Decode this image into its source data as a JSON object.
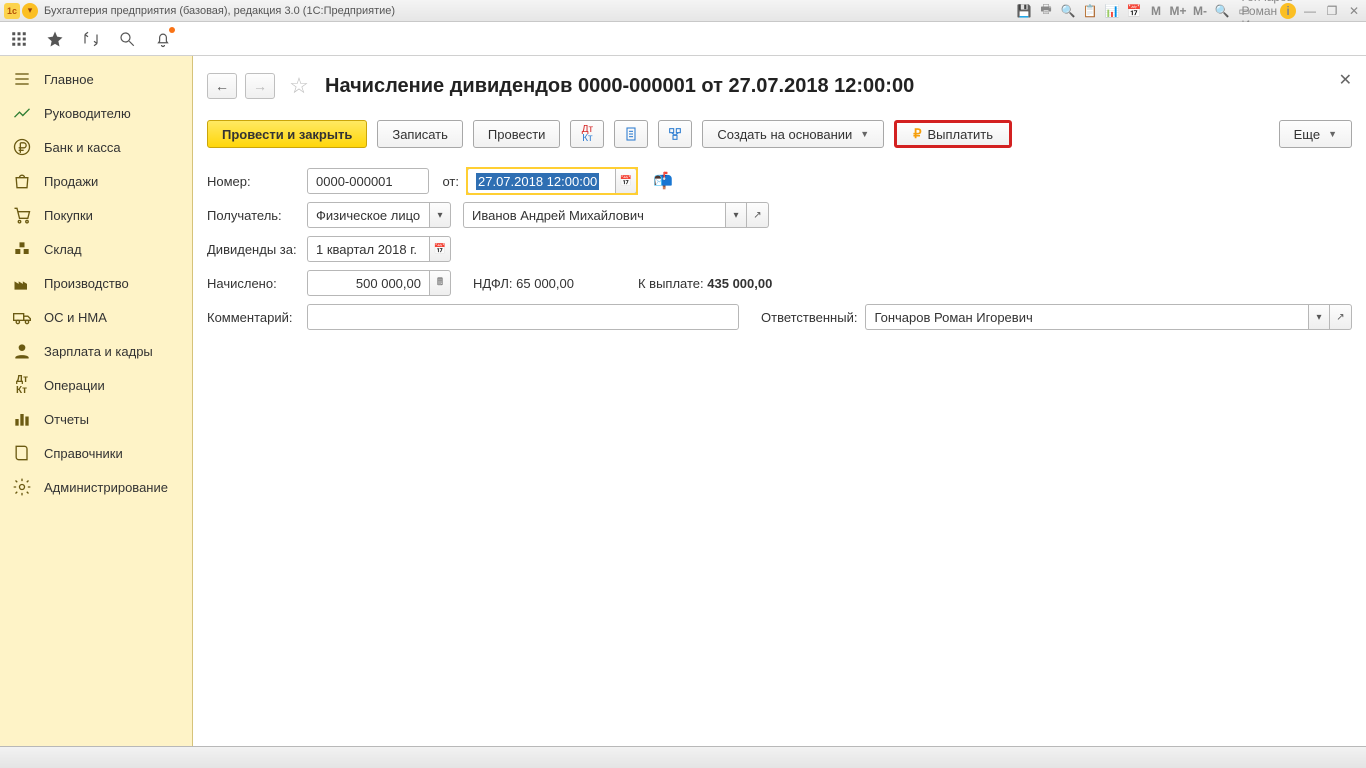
{
  "window": {
    "title": "Бухгалтерия предприятия (базовая), редакция 3.0  (1С:Предприятие)",
    "user": "Гончаров Роман Игоревич",
    "m_labels": [
      "M",
      "M+",
      "M-"
    ]
  },
  "sidebar": {
    "items": [
      {
        "label": "Главное"
      },
      {
        "label": "Руководителю"
      },
      {
        "label": "Банк и касса"
      },
      {
        "label": "Продажи"
      },
      {
        "label": "Покупки"
      },
      {
        "label": "Склад"
      },
      {
        "label": "Производство"
      },
      {
        "label": "ОС и НМА"
      },
      {
        "label": "Зарплата и кадры"
      },
      {
        "label": "Операции"
      },
      {
        "label": "Отчеты"
      },
      {
        "label": "Справочники"
      },
      {
        "label": "Администрирование"
      }
    ]
  },
  "page": {
    "title": "Начисление дивидендов 0000-000001 от 27.07.2018 12:00:00"
  },
  "toolbar": {
    "post_close": "Провести и закрыть",
    "save": "Записать",
    "post": "Провести",
    "create_based": "Создать на основании",
    "payout": "Выплатить",
    "more": "Еще"
  },
  "form": {
    "number_label": "Номер:",
    "number_value": "0000-000001",
    "from_label": "от:",
    "date_value": "27.07.2018 12:00:00",
    "recipient_label": "Получатель:",
    "recipient_type": "Физическое лицо",
    "recipient_name": "Иванов Андрей Михайлович",
    "dividends_for_label": "Дивиденды за:",
    "dividends_for_value": "1 квартал 2018 г.",
    "accrued_label": "Начислено:",
    "accrued_value": "500 000,00",
    "ndfl_label": "НДФЛ:",
    "ndfl_value": "65 000,00",
    "to_pay_label": "К выплате:",
    "to_pay_value": "435 000,00",
    "comment_label": "Комментарий:",
    "comment_value": "",
    "responsible_label": "Ответственный:",
    "responsible_value": "Гончаров Роман Игоревич"
  }
}
